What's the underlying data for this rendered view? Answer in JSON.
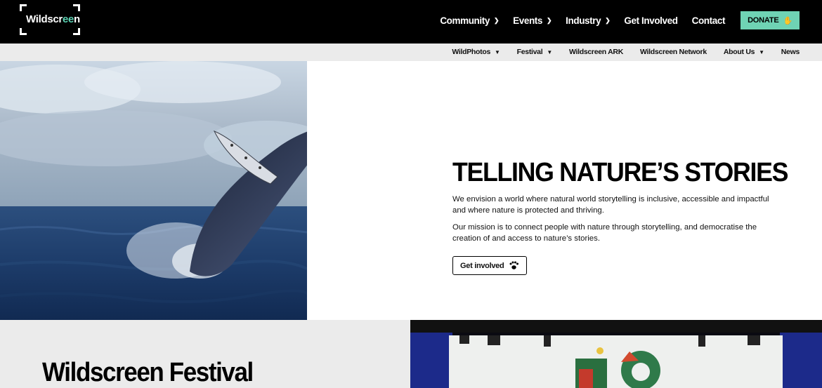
{
  "brand": {
    "logo_text_pre": "Wildscr",
    "logo_text_accent": "ee",
    "logo_text_post": "n",
    "accent_color": "#6fd3b4"
  },
  "main_nav": {
    "items": [
      {
        "label": "Community",
        "has_dropdown": true
      },
      {
        "label": "Events",
        "has_dropdown": true
      },
      {
        "label": "Industry",
        "has_dropdown": true
      },
      {
        "label": "Get Involved",
        "has_dropdown": false
      },
      {
        "label": "Contact",
        "has_dropdown": false
      }
    ],
    "donate_label": "DONATE"
  },
  "sub_nav": {
    "items": [
      {
        "label": "WildPhotos",
        "has_dropdown": true
      },
      {
        "label": "Festival",
        "has_dropdown": true
      },
      {
        "label": "Wildscreen ARK",
        "has_dropdown": false
      },
      {
        "label": "Wildscreen Network",
        "has_dropdown": false
      },
      {
        "label": "About Us",
        "has_dropdown": true
      },
      {
        "label": "News",
        "has_dropdown": false
      }
    ]
  },
  "hero": {
    "image_icon": "humpback-whale-breaching-photo",
    "title": "TELLING NATURE’S STORIES",
    "paragraph_1": "We envision a world where natural world storytelling is inclusive, accessible and impactful and where nature is protected and thriving.",
    "paragraph_2": "Our mission is to connect people with nature through storytelling, and democratise the creation of and access to nature’s stories.",
    "button_label": "Get involved"
  },
  "festival": {
    "title": "Wildscreen Festival",
    "image_icon": "festival-stage-40-photo"
  }
}
